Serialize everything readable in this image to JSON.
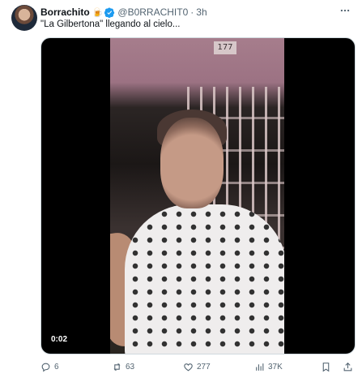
{
  "author": {
    "name": "Borrachito",
    "emoji": "🍺",
    "handle": "@B0RRACHIT0",
    "separator": "·",
    "time": "3h"
  },
  "tweet": {
    "text": "\"La Gilbertona\" llegando al cielo..."
  },
  "media": {
    "duration": "0:02",
    "plate_number": "177"
  },
  "actions": {
    "replies": "6",
    "reposts": "63",
    "likes": "277",
    "views": "37K"
  },
  "icons": {
    "more": "more-icon",
    "reply": "reply-icon",
    "repost": "repost-icon",
    "like": "heart-icon",
    "views": "views-icon",
    "bookmark": "bookmark-icon",
    "share": "share-icon",
    "verified": "verified-badge-icon"
  },
  "colors": {
    "text": "#0f1419",
    "secondary": "#536471",
    "verified": "#1d9bf0"
  }
}
